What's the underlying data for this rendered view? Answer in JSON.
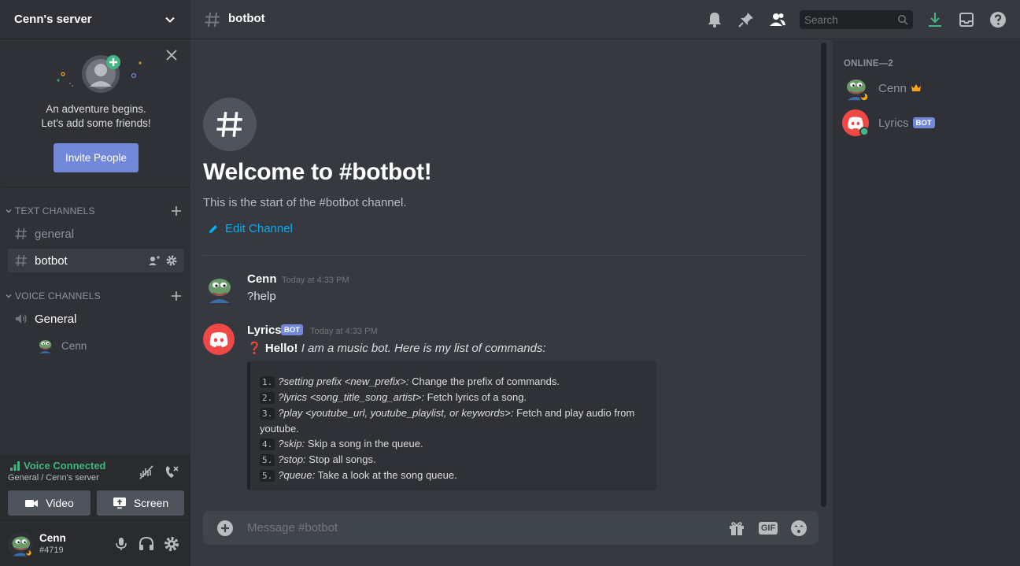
{
  "server": {
    "name": "Cenn's server"
  },
  "invite": {
    "line1": "An adventure begins.",
    "line2": "Let's add some friends!",
    "button": "Invite People"
  },
  "sidebar": {
    "text_category": "TEXT CHANNELS",
    "text_channels": [
      {
        "name": "general",
        "active": false
      },
      {
        "name": "botbot",
        "active": true
      }
    ],
    "voice_category": "VOICE CHANNELS",
    "voice_channels": [
      {
        "name": "General",
        "members": [
          "Cenn"
        ]
      }
    ]
  },
  "voice": {
    "status": "Voice Connected",
    "location": "General / Cenn's server",
    "video_label": "Video",
    "screen_label": "Screen"
  },
  "user": {
    "name": "Cenn",
    "tag": "#4719"
  },
  "topbar": {
    "channel": "botbot",
    "search_placeholder": "Search"
  },
  "welcome": {
    "title": "Welcome to #botbot!",
    "subtitle": "This is the start of the #botbot channel.",
    "edit_label": "Edit Channel"
  },
  "messages": [
    {
      "author": "Cenn",
      "time": "Today at 4:33 PM",
      "text": "?help",
      "bot": false
    },
    {
      "author": "Lyrics",
      "bot": true,
      "bot_label": "BOT",
      "time": "Today at 4:33 PM",
      "emoji": "❓",
      "bold": "Hello!",
      "italic": "I am a music bot. Here is my list of commands:",
      "commands": [
        {
          "n": "1.",
          "cmd": "?setting prefix <new_prefix>:",
          "desc": "Change the prefix of commands."
        },
        {
          "n": "2.",
          "cmd": "?lyrics <song_title_song_artist>:",
          "desc": "Fetch lyrics of a song."
        },
        {
          "n": "3.",
          "cmd": "?play <youtube_url, youtube_playlist, or keywords>:",
          "desc": "Fetch and play audio from youtube."
        },
        {
          "n": "4.",
          "cmd": "?skip:",
          "desc": "Skip a song in the queue."
        },
        {
          "n": "5.",
          "cmd": "?stop:",
          "desc": "Stop all songs."
        },
        {
          "n": "5.",
          "cmd": "?queue:",
          "desc": "Take a look at the song queue."
        }
      ]
    }
  ],
  "composer": {
    "placeholder": "Message #botbot",
    "gif_label": "GIF"
  },
  "members": {
    "header": "ONLINE—2",
    "list": [
      {
        "name": "Cenn",
        "owner": true
      },
      {
        "name": "Lyrics",
        "bot_label": "BOT"
      }
    ]
  },
  "colors": {
    "accent": "#7289da",
    "online": "#43b581",
    "link": "#00b0f4",
    "discord_red": "#f04747"
  }
}
